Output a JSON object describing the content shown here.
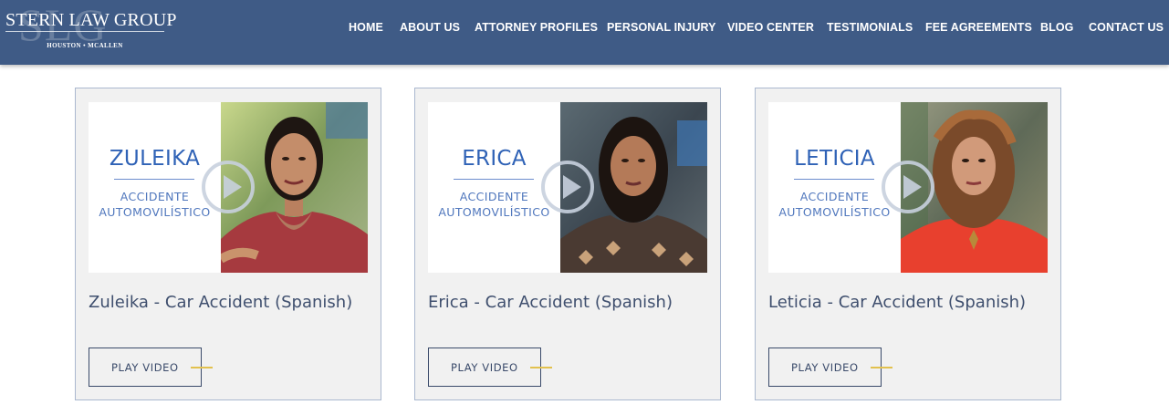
{
  "header": {
    "logo": {
      "monogram": "SLG",
      "name": "STERN LAW GROUP",
      "locations": "HOUSTON • MCALLEN"
    },
    "nav": [
      {
        "label": "HOME"
      },
      {
        "label": "ABOUT US"
      },
      {
        "label": "ATTORNEY PROFILES"
      },
      {
        "label": "PERSONAL INJURY"
      },
      {
        "label": "VIDEO CENTER"
      },
      {
        "label": "TESTIMONIALS"
      },
      {
        "label": "FEE AGREEMENTS"
      },
      {
        "label": "BLOG"
      },
      {
        "label": "CONTACT US"
      }
    ]
  },
  "videos": [
    {
      "thumb_name": "ZULEIKA",
      "thumb_subtitle": "ACCIDENTE\nAUTOMOVILÍSTICO",
      "title": "Zuleika - Car Accident (Spanish)",
      "button_label": "PLAY VIDEO"
    },
    {
      "thumb_name": "ERICA",
      "thumb_subtitle": "ACCIDENTE\nAUTOMOVILÍSTICO",
      "title": "Erica - Car Accident (Spanish)",
      "button_label": "PLAY VIDEO"
    },
    {
      "thumb_name": "LETICIA",
      "thumb_subtitle": "ACCIDENTE\nAUTOMOVILÍSTICO",
      "title": "Leticia - Car Accident (Spanish)",
      "button_label": "PLAY VIDEO"
    }
  ],
  "colors": {
    "header_bg": "#3f5b86",
    "card_bg": "#f1f1f1",
    "card_border": "#aab8cf",
    "thumb_text": "#2f62b6",
    "title_text": "#3f4f6e",
    "button_accent": "#e2c14e"
  }
}
